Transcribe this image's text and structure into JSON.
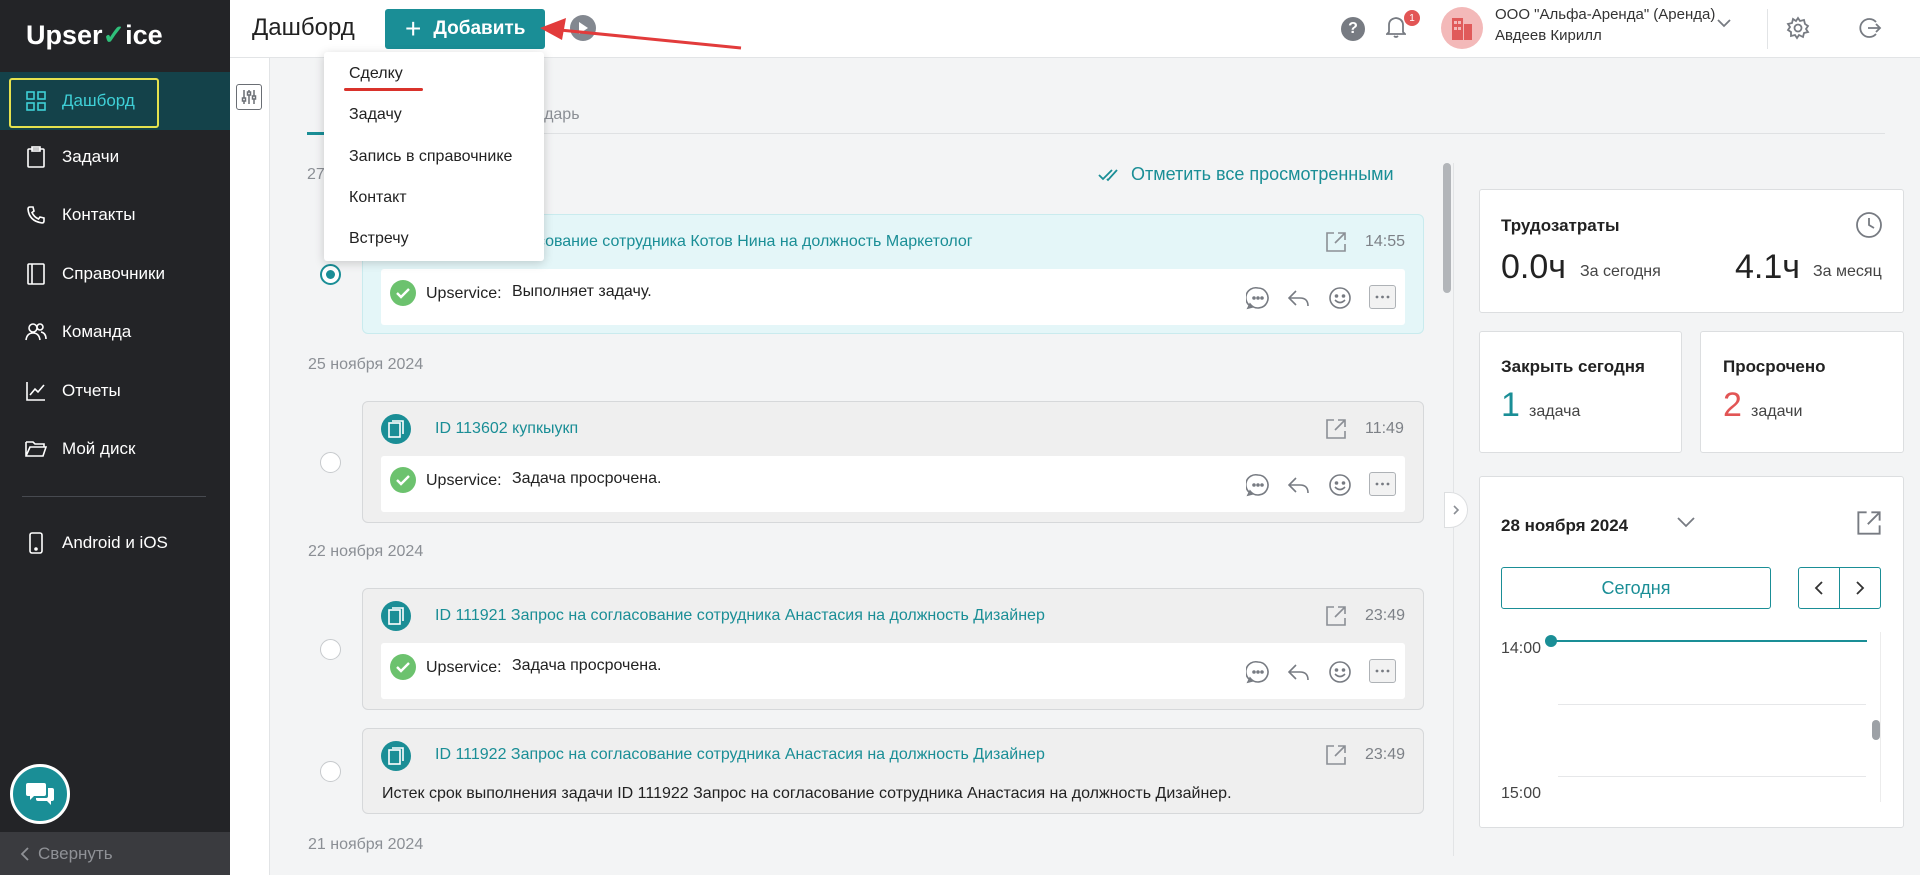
{
  "app": {
    "logo_text_1": "Upser",
    "logo_text_2": "ice",
    "title": "Дашборд"
  },
  "sidebar": {
    "items": [
      {
        "label": "Дашборд",
        "icon": "grid-icon",
        "active": true
      },
      {
        "label": "Задачи",
        "icon": "clipboard-icon"
      },
      {
        "label": "Контакты",
        "icon": "phone-icon"
      },
      {
        "label": "Справочники",
        "icon": "book-icon"
      },
      {
        "label": "Команда",
        "icon": "team-icon"
      },
      {
        "label": "Отчеты",
        "icon": "chart-icon"
      },
      {
        "label": "Мой диск",
        "icon": "folder-icon"
      },
      {
        "label": "Android и iOS",
        "icon": "mobile-icon"
      }
    ],
    "collapse_label": "Свернуть"
  },
  "header": {
    "add_label": "Добавить",
    "help": "?",
    "notification_count": "1",
    "org_name": "ООО \"Альфа-Аренда\" (Аренда)",
    "user_name": "Авдеев Кирилл"
  },
  "dropdown": {
    "items": [
      "Сделку",
      "Задачу",
      "Запись в справочнике",
      "Контакт",
      "Встречу"
    ]
  },
  "tabs": {
    "calendar": "лендарь"
  },
  "feed": {
    "mark_all_label": "Отметить все просмотренными",
    "first_date_partial": "27",
    "dates": [
      "25 ноября 2024",
      "22 ноября 2024",
      "21 ноября 2024"
    ],
    "cards": [
      {
        "title": "прос на согласование сотрудника Котов Нина на должность Маркетолог",
        "time": "14:55",
        "author": "Upservice:",
        "message": "Выполняет задачу."
      },
      {
        "title": "ID 113602 купкыукп",
        "time": "11:49",
        "author": "Upservice:",
        "message": "Задача просрочена."
      },
      {
        "title": "ID 111921 Запрос на согласование сотрудника Анастасия на должность Дизайнер",
        "time": "23:49",
        "author": "Upservice:",
        "message": "Задача просрочена."
      },
      {
        "title": "ID 111922 Запрос на согласование сотрудника Анастасия на должность Дизайнер",
        "time": "23:49",
        "message": "Истек срок выполнения задачи ID 111922 Запрос на согласование сотрудника Анастасия на должность Дизайнер."
      }
    ]
  },
  "right": {
    "labor": {
      "title": "Трудозатраты",
      "today_value": "0.0ч",
      "today_label": "За сегодня",
      "month_value": "4.1ч",
      "month_label": "За месяц"
    },
    "close_today": {
      "title": "Закрыть сегодня",
      "value": "1",
      "label": "задача"
    },
    "overdue": {
      "title": "Просрочено",
      "value": "2",
      "label": "задачи"
    },
    "calendar": {
      "date": "28 ноября 2024",
      "today_label": "Сегодня",
      "times": [
        "14:00",
        "15:00"
      ]
    }
  },
  "colors": {
    "accent": "#1a8e96",
    "sidebar_bg": "#232427",
    "danger": "#e25555",
    "highlight": "#e5e24e"
  }
}
